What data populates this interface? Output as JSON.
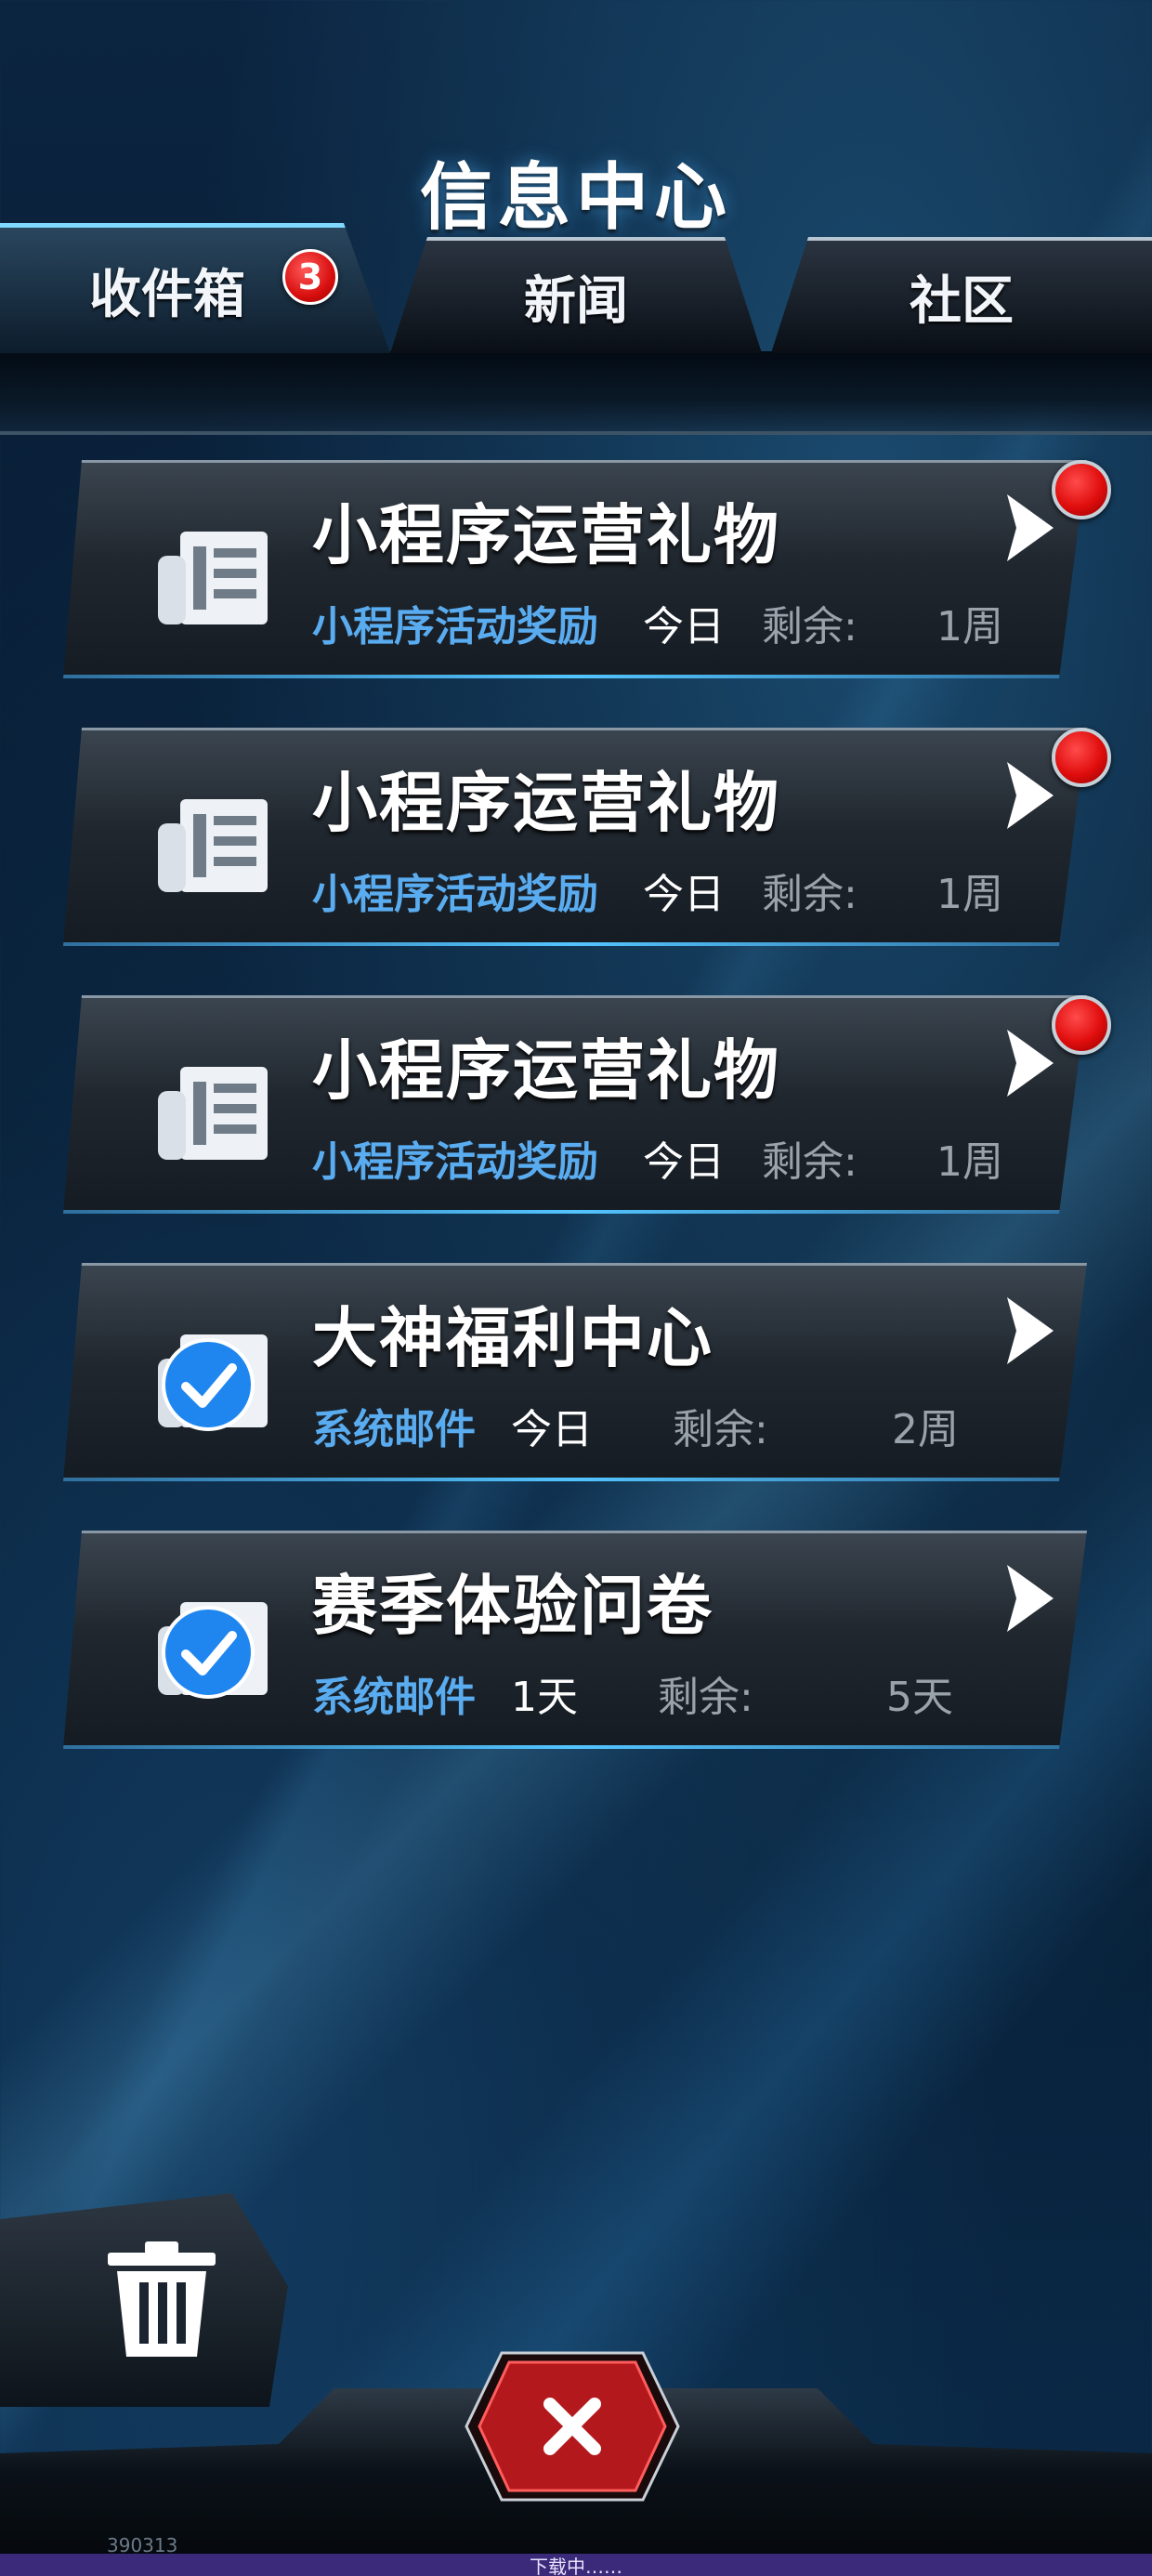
{
  "header": {
    "title": "信息中心"
  },
  "tabs": [
    {
      "label": "收件箱",
      "badge": "3",
      "active": true
    },
    {
      "label": "新闻",
      "active": false
    },
    {
      "label": "社区",
      "active": false
    }
  ],
  "messages": [
    {
      "icon": "newspaper-icon",
      "title": "小程序运营礼物",
      "sender": "小程序活动奖励",
      "date": "今日",
      "remain_label": "剩余:",
      "remain_value": "1周",
      "unread": true
    },
    {
      "icon": "newspaper-icon",
      "title": "小程序运营礼物",
      "sender": "小程序活动奖励",
      "date": "今日",
      "remain_label": "剩余:",
      "remain_value": "1周",
      "unread": true
    },
    {
      "icon": "newspaper-icon",
      "title": "小程序运营礼物",
      "sender": "小程序活动奖励",
      "date": "今日",
      "remain_label": "剩余:",
      "remain_value": "1周",
      "unread": true
    },
    {
      "icon": "checked-mail-icon",
      "title": "大神福利中心",
      "sender": "系统邮件",
      "date": "今日",
      "remain_label": "剩余:",
      "remain_value": "2周",
      "unread": false
    },
    {
      "icon": "checked-mail-icon",
      "title": "赛季体验问卷",
      "sender": "系统邮件",
      "date": "1天",
      "remain_label": "剩余:",
      "remain_value": "5天",
      "unread": false
    }
  ],
  "footer": {
    "trash_icon": "trash-icon",
    "close_icon": "close-icon",
    "version": "390313",
    "loading": "下载中……"
  },
  "colors": {
    "accent_blue": "#5aacf0",
    "unread_red": "#e00d0d",
    "close_red": "#b3181c",
    "loading_bar": "#3b2a7a"
  }
}
